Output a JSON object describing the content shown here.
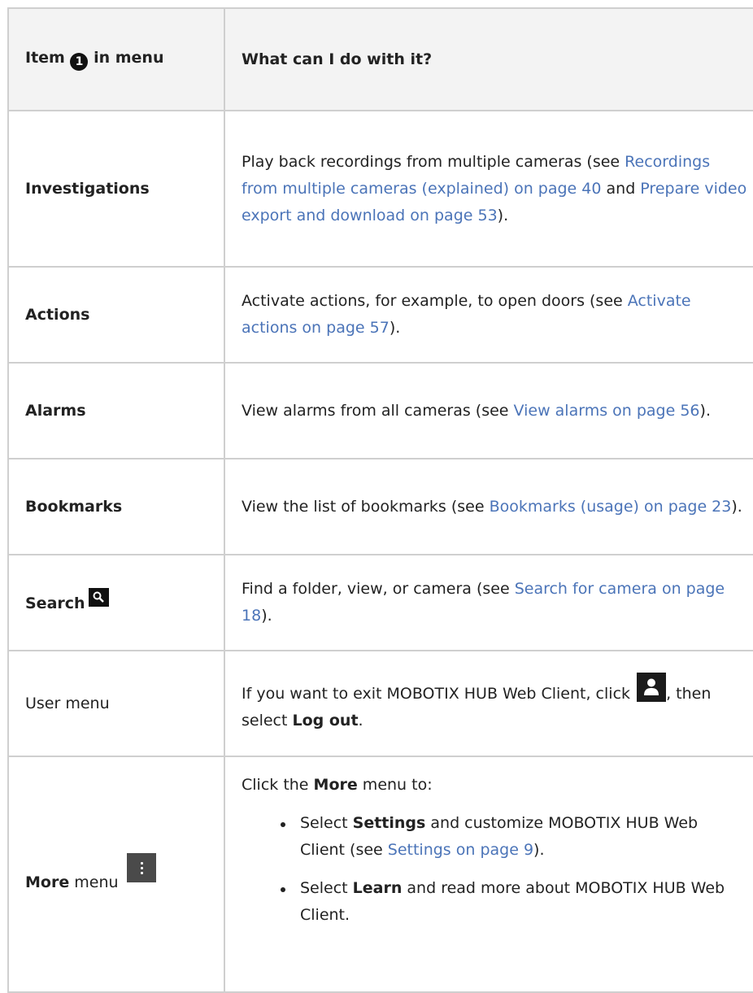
{
  "header": {
    "col1_before": "Item",
    "col1_badge": "1",
    "col1_after": "in menu",
    "col2": "What can I do with it?"
  },
  "rows": [
    {
      "item": "Investigations",
      "t1": "Play back recordings from multiple cameras (see ",
      "link1": "Recordings from multiple cameras (explained) on page 40",
      "t2": " and ",
      "link2": "Prepare video export and download on page 53",
      "t3": ")."
    },
    {
      "item": "Actions",
      "t1": "Activate actions, for example, to open doors (see ",
      "link1": "Activate actions on page 57",
      "t2": ")."
    },
    {
      "item": "Alarms",
      "t1": "View alarms from all cameras (see ",
      "link1": "View alarms on page 56",
      "t2": ")."
    },
    {
      "item": "Bookmarks",
      "t1": "View the list of bookmarks (see ",
      "link1": "Bookmarks (usage) on page 23",
      "t2": ")."
    },
    {
      "item": "Search",
      "t1": "Find a folder, view, or camera (see ",
      "link1": "Search for camera on page 18",
      "t2": ")."
    },
    {
      "item": "User menu",
      "t1": "If you want to exit MOBOTIX HUB Web Client, click ",
      "t2": ", then select ",
      "bold1": "Log out",
      "t3": "."
    },
    {
      "item_bold": "More",
      "item_rest": " menu",
      "intro1": "Click the ",
      "intro_bold": "More",
      "intro2": " menu to:",
      "bullets": [
        {
          "pre": "Select ",
          "bold": "Settings",
          "mid": " and customize MOBOTIX HUB Web Client (see ",
          "link": "Settings on page 9",
          "post": ")."
        },
        {
          "pre": "Select ",
          "bold": "Learn",
          "mid": " and read more about MOBOTIX HUB Web Client."
        }
      ]
    }
  ],
  "icons": {
    "badge": "numbered-circle-icon",
    "search": "magnifier-icon",
    "user": "user-person-icon",
    "more": "vertical-ellipsis-icon"
  },
  "colors": {
    "link": "#4b74b8",
    "header_bg": "#f3f3f3",
    "border": "#cfcfcf"
  }
}
